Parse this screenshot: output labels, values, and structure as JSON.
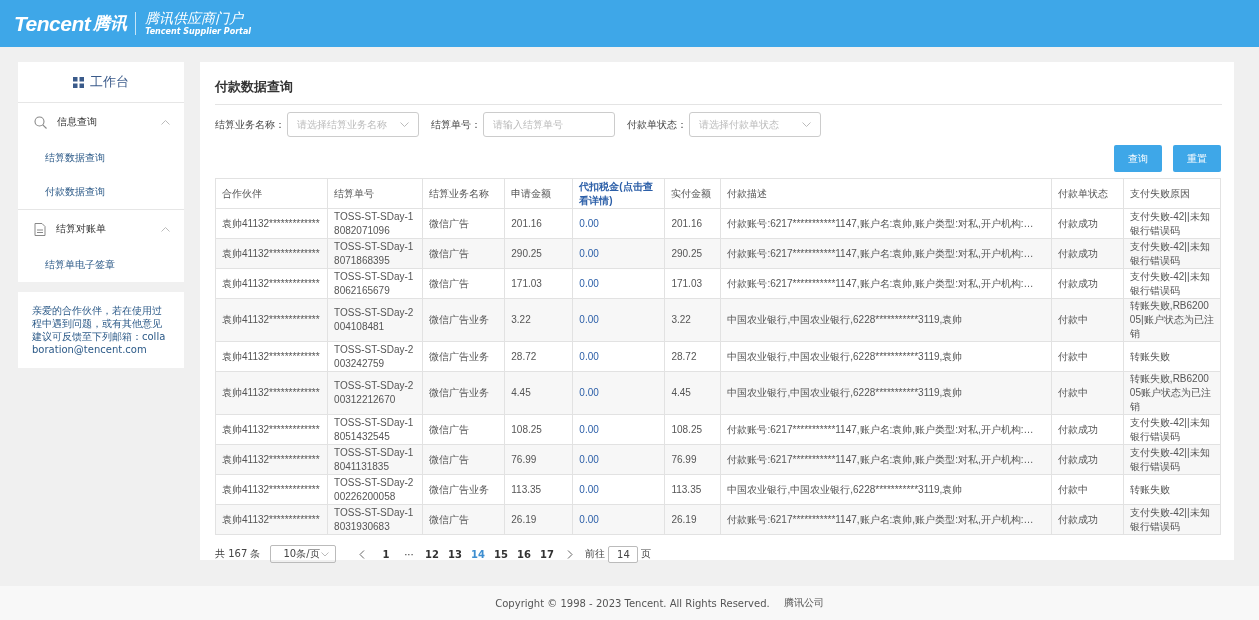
{
  "header": {
    "logo": "Tencent",
    "logo_cn": "腾讯",
    "portal_title": "腾讯供应商门户",
    "portal_subtitle": "Tencent Supplier Portal"
  },
  "sidebar": {
    "workbench": "工作台",
    "groups": [
      {
        "label": "信息查询",
        "kind": "search",
        "expanded": true,
        "children": [
          {
            "label": "结算数据查询"
          },
          {
            "label": "付款数据查询"
          }
        ]
      },
      {
        "label": "结算对账单",
        "kind": "document",
        "expanded": true,
        "children": [
          {
            "label": "结算单电子签章"
          }
        ]
      }
    ],
    "notice": "亲爱的合作伙伴，若在使用过程中遇到问题，或有其他意见建议可反馈至下列邮箱：collaboration@tencent.com"
  },
  "main": {
    "title": "付款数据查询",
    "filters": [
      {
        "label": "结算业务名称：",
        "kind": "select",
        "placeholder": "请选择结算业务名称"
      },
      {
        "label": "结算单号：",
        "kind": "input",
        "placeholder": "请输入结算单号"
      },
      {
        "label": "付款单状态：",
        "kind": "select",
        "placeholder": "请选择付款单状态"
      }
    ],
    "buttons": [
      "查询",
      "重置"
    ],
    "table": {
      "columns": [
        {
          "label": "合作伙伴",
          "link": false
        },
        {
          "label": "结算单号",
          "link": false
        },
        {
          "label": "结算业务名称",
          "link": false
        },
        {
          "label": "申请金额",
          "link": false
        },
        {
          "label": "代扣税金(点击查看详情)",
          "link": true
        },
        {
          "label": "实付金额",
          "link": false
        },
        {
          "label": "付款描述",
          "link": false
        },
        {
          "label": "付款单状态",
          "link": false
        },
        {
          "label": "支付失败原因",
          "link": false
        }
      ],
      "rows": [
        [
          "袁帅41132*************",
          "TOSS-ST-SDay-18082071096",
          "微信广告",
          "201.16",
          "0.00",
          "201.16",
          "付款账号:6217***********1147,账户名:袁帅,账户类型:对私,开户机构:…",
          "付款成功",
          "支付失败-42||未知银行错误码"
        ],
        [
          "袁帅41132*************",
          "TOSS-ST-SDay-18071868395",
          "微信广告",
          "290.25",
          "0.00",
          "290.25",
          "付款账号:6217***********1147,账户名:袁帅,账户类型:对私,开户机构:…",
          "付款成功",
          "支付失败-42||未知银行错误码"
        ],
        [
          "袁帅41132*************",
          "TOSS-ST-SDay-18062165679",
          "微信广告",
          "171.03",
          "0.00",
          "171.03",
          "付款账号:6217***********1147,账户名:袁帅,账户类型:对私,开户机构:…",
          "付款成功",
          "支付失败-42||未知银行错误码"
        ],
        [
          "袁帅41132*************",
          "TOSS-ST-SDay-2004108481",
          "微信广告业务",
          "3.22",
          "0.00",
          "3.22",
          "中国农业银行,中国农业银行,6228***********3119,袁帅",
          "付款中",
          "转账失败,RB620005|账户状态为已注销"
        ],
        [
          "袁帅41132*************",
          "TOSS-ST-SDay-2003242759",
          "微信广告业务",
          "28.72",
          "0.00",
          "28.72",
          "中国农业银行,中国农业银行,6228***********3119,袁帅",
          "付款中",
          "转账失败"
        ],
        [
          "袁帅41132*************",
          "TOSS-ST-SDay-200312212670",
          "微信广告业务",
          "4.45",
          "0.00",
          "4.45",
          "中国农业银行,中国农业银行,6228***********3119,袁帅",
          "付款中",
          "转账失败,RB620005账户状态为已注销"
        ],
        [
          "袁帅41132*************",
          "TOSS-ST-SDay-18051432545",
          "微信广告",
          "108.25",
          "0.00",
          "108.25",
          "付款账号:6217***********1147,账户名:袁帅,账户类型:对私,开户机构:…",
          "付款成功",
          "支付失败-42||未知银行错误码"
        ],
        [
          "袁帅41132*************",
          "TOSS-ST-SDay-18041131835",
          "微信广告",
          "76.99",
          "0.00",
          "76.99",
          "付款账号:6217***********1147,账户名:袁帅,账户类型:对私,开户机构:…",
          "付款成功",
          "支付失败-42||未知银行错误码"
        ],
        [
          "袁帅41132*************",
          "TOSS-ST-SDay-200226200058",
          "微信广告业务",
          "113.35",
          "0.00",
          "113.35",
          "中国农业银行,中国农业银行,6228***********3119,袁帅",
          "付款中",
          "转账失败"
        ],
        [
          "袁帅41132*************",
          "TOSS-ST-SDay-18031930683",
          "微信广告",
          "26.19",
          "0.00",
          "26.19",
          "付款账号:6217***********1147,账户名:袁帅,账户类型:对私,开户机构:…",
          "付款成功",
          "支付失败-42||未知银行错误码"
        ]
      ]
    },
    "pagination": {
      "total": "共 167 条",
      "page_size": "10条/页",
      "pages": [
        {
          "label": "1",
          "kind": "page",
          "selected": false
        },
        {
          "label": "···",
          "kind": "more",
          "selected": false
        },
        {
          "label": "12",
          "kind": "page",
          "selected": false
        },
        {
          "label": "13",
          "kind": "page",
          "selected": false
        },
        {
          "label": "14",
          "kind": "page",
          "selected": true
        },
        {
          "label": "15",
          "kind": "page",
          "selected": false
        },
        {
          "label": "16",
          "kind": "page",
          "selected": false
        },
        {
          "label": "17",
          "kind": "page",
          "selected": false
        }
      ],
      "goto_label": "前往",
      "goto_value": "14",
      "goto_unit": "页"
    }
  },
  "footer": {
    "copyright": "Copyright © 1998 - 2023 Tencent. All Rights Reserved.",
    "company": "腾讯公司"
  }
}
